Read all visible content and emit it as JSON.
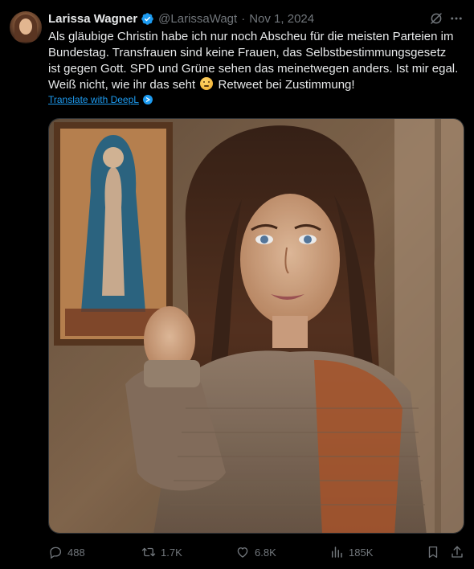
{
  "author": {
    "name": "Larissa Wagner",
    "handle": "@LarissaWagt",
    "separator": "·",
    "date": "Nov 1, 2024",
    "verified": true,
    "verified_color": "#1d9bf0"
  },
  "tweet": {
    "lines": [
      "Als gläubige Christin habe ich nur noch Abscheu für die meisten Parteien im",
      "Bundestag. Transfrauen sind keine Frauen, das Selbstbestimmungsgesetz",
      "ist gegen Gott. SPD und Grüne sehen das meinetwegen anders. Ist mir egal.",
      "Weiß nicht, wie ihr das seht",
      "Retweet bei Zustimmung!"
    ],
    "emoji": "thinking-face",
    "translate_label": "Translate with DeepL"
  },
  "actions": {
    "reply_count": "488",
    "retweet_count": "1.7K",
    "like_count": "6.8K",
    "views_count": "185K"
  },
  "icons": {
    "grok": "grok-icon",
    "more": "more-icon",
    "reply": "reply-icon",
    "retweet": "retweet-icon",
    "like": "heart-icon",
    "views": "views-icon",
    "bookmark": "bookmark-icon",
    "share": "share-icon",
    "deepl": "deepl-icon"
  },
  "colors": {
    "background": "#000000",
    "text": "#e7e9ea",
    "muted": "#71767b",
    "link": "#1d9bf0"
  }
}
